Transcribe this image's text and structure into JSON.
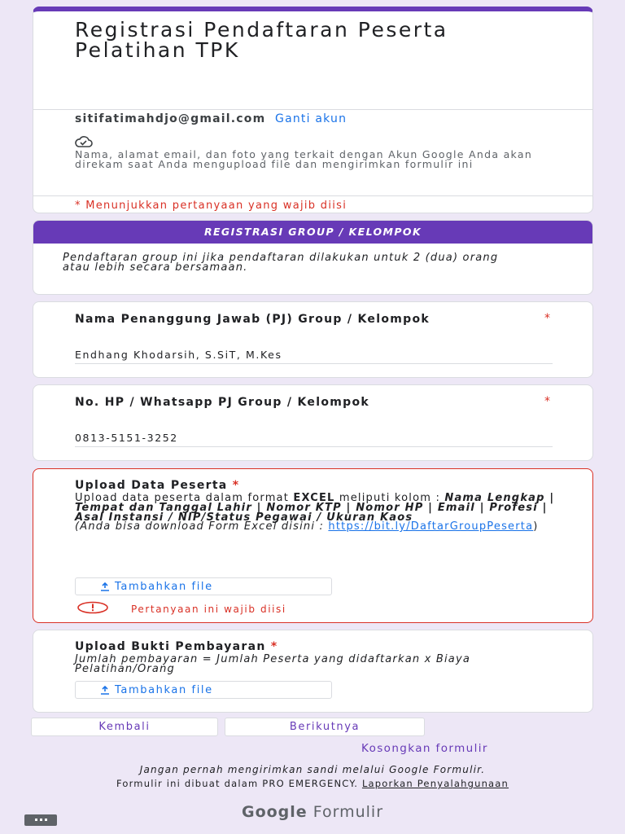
{
  "form": {
    "title": "Registrasi Pendaftaran Peserta Pelatihan TPK",
    "account_email": "sitifatimahdjo@gmail.com",
    "switch_account": "Ganti akun",
    "privacy_note": "Nama, alamat email, dan foto yang terkait dengan Akun Google Anda akan direkam saat Anda mengupload file dan mengirimkan formulir ini",
    "required_note": "* Menunjukkan pertanyaan yang wajib diisi"
  },
  "section": {
    "title": "REGISTRASI GROUP / KELOMPOK",
    "description": "Pendaftaran group ini jika pendaftaran dilakukan untuk 2 (dua) orang atau lebih secara bersamaan."
  },
  "questions": {
    "pj_name": {
      "title": "Nama Penanggung Jawab (PJ) Group / Kelompok",
      "required_mark": "*",
      "value": "Endhang Khodarsih, S.SiT, M.Kes"
    },
    "pj_phone": {
      "title": "No. HP / Whatsapp PJ Group / Kelompok",
      "required_mark": "*",
      "value": "0813-5151-3252"
    },
    "upload_data": {
      "title": "Upload Data Peserta",
      "required_mark": "*",
      "desc_1": "Upload data peserta dalam format ",
      "desc_excel": "EXCEL",
      "desc_2": " meliputi kolom : ",
      "desc_columns": "Nama Lengkap | Tempat dan Tanggal Lahir | Nomor KTP | Nomor HP | Email | Profesi | Asal Instansi / NIP/Status Pegawai / Ukuran Kaos",
      "desc_download": "(Anda bisa download Form Excel disini : ",
      "download_link": "https://bit.ly/DaftarGroupPeserta",
      "desc_close": ")",
      "add_file": "Tambahkan file",
      "error": "Pertanyaan ini wajib diisi"
    },
    "upload_payment": {
      "title": "Upload Bukti Pembayaran",
      "required_mark": "*",
      "description": "Jumlah pembayaran = Jumlah Peserta yang didaftarkan x Biaya Pelatihan/Orang",
      "add_file": "Tambahkan file"
    }
  },
  "nav": {
    "back": "Kembali",
    "next": "Berikutnya",
    "clear": "Kosongkan formulir"
  },
  "footer": {
    "warning": "Jangan pernah mengirimkan sandi melalui Google Formulir.",
    "made_by": "Formulir ini dibuat dalam PRO EMERGENCY. ",
    "report": "Laporkan Penyalahgunaan",
    "logo_google": "Google",
    "logo_forms": " Formulir"
  },
  "colors": {
    "accent": "#673ab7",
    "background": "#ede7f6",
    "error": "#d93025",
    "link": "#1a73e8"
  },
  "icons": [
    "cloud-icon",
    "upload-icon",
    "error-icon",
    "feedback-icon"
  ]
}
